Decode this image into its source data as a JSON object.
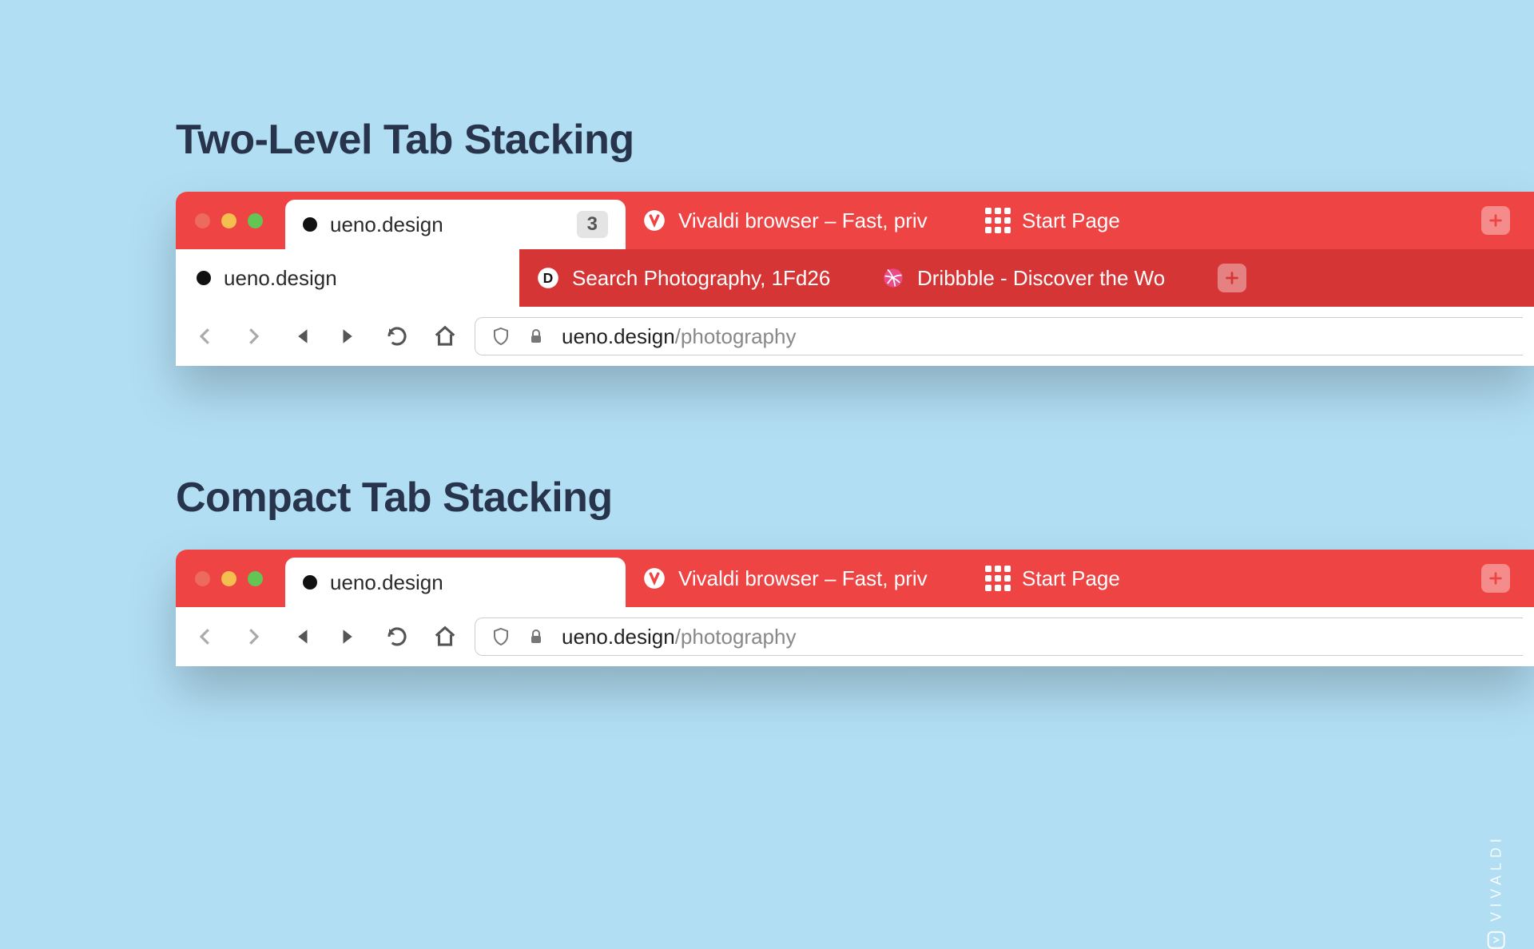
{
  "headings": {
    "two_level": "Two-Level Tab Stacking",
    "compact": "Compact Tab Stacking"
  },
  "colors": {
    "background": "#B2DEF4",
    "tabbar_primary": "#EF4444",
    "tabbar_secondary": "#D63535",
    "heading": "#27344B"
  },
  "two_level": {
    "top_tabs": [
      {
        "label": "ueno.design",
        "active": true,
        "count": "3"
      },
      {
        "label": "Vivaldi browser – Fast, priv",
        "icon": "vivaldi"
      },
      {
        "label": "Start Page",
        "icon": "grid"
      }
    ],
    "sub_tabs": [
      {
        "label": "ueno.design",
        "active": true
      },
      {
        "label": "Search Photography, 1Fd26",
        "icon": "disqus"
      },
      {
        "label": "Dribbble - Discover the Wo",
        "icon": "dribbble"
      }
    ]
  },
  "compact": {
    "tabs": [
      {
        "label": "ueno.design",
        "active": true,
        "stack_widths": [
          130,
          130,
          120
        ]
      },
      {
        "label": "Vivaldi browser – Fast, priv",
        "icon": "vivaldi"
      },
      {
        "label": "Start Page",
        "icon": "grid"
      }
    ]
  },
  "address": {
    "host": "ueno.design",
    "path": "/photography"
  },
  "watermark": "VIVALDI"
}
